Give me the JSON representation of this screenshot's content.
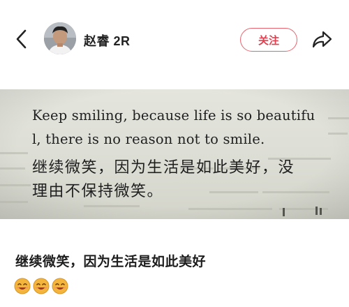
{
  "header": {
    "back_icon": "chevron-left-icon",
    "username": "赵睿 2R",
    "follow_label": "关注",
    "share_icon": "share-arrow-icon",
    "accent": "#e2404f"
  },
  "photo": {
    "lines": [
      "Keep smiling, because life is so beautifu",
      "l, there is no reason not to smile.",
      "继续微笑，因为生活是如此美好，没",
      "理由不保持微笑。"
    ]
  },
  "post": {
    "caption": "继续微笑，因为生活是如此美好",
    "emoji_icon": "smiling-face-emoji-icon"
  }
}
